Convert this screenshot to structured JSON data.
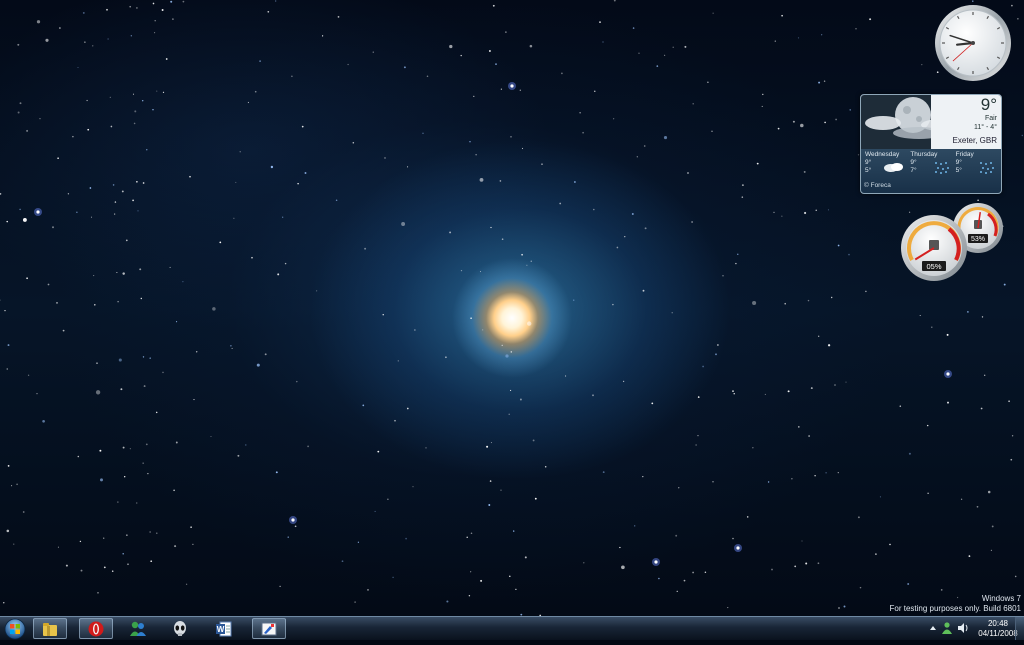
{
  "desktop": {
    "wallpaper": "galaxy-spiral"
  },
  "gadgets": {
    "clock": {
      "hour": 8,
      "minute": 48,
      "second": 38
    },
    "weather": {
      "temp": "9°",
      "condition": "Fair",
      "high": "11°",
      "separator": "-",
      "low": "4°",
      "location": "Exeter, GBR",
      "forecast": [
        {
          "day": "Wednesday",
          "high": "9°",
          "low": "5°",
          "icon": "cloudy-icon"
        },
        {
          "day": "Thursday",
          "high": "9°",
          "low": "7°",
          "icon": "rain-icon"
        },
        {
          "day": "Friday",
          "high": "9°",
          "low": "5°",
          "icon": "rain-icon"
        }
      ],
      "credit": "© Foreca"
    },
    "meter": {
      "cpu_label": "05%",
      "memory_label": "53%",
      "cpu": 0.05,
      "memory": 0.53
    }
  },
  "watermark": {
    "line1": "Windows 7",
    "line2": "For testing purposes only. Build 6801"
  },
  "taskbar": {
    "start_icon": "windows-orb-icon",
    "pinned": [
      {
        "name": "windows-explorer",
        "icon": "folder-icon",
        "active": true
      },
      {
        "name": "opera",
        "icon": "opera-icon",
        "active": true
      },
      {
        "name": "messenger",
        "icon": "messenger-icon",
        "active": false
      },
      {
        "name": "media-player",
        "icon": "alien-icon",
        "active": false
      },
      {
        "name": "word",
        "icon": "word-icon",
        "active": false
      },
      {
        "name": "paint",
        "icon": "paint-icon",
        "active": true
      }
    ],
    "tray": {
      "icons": [
        "show-hidden-icons-icon",
        "network-icon",
        "volume-icon"
      ],
      "time": "20:48",
      "date": "04/11/2008"
    }
  },
  "colors": {
    "accent": "#3f6fa0",
    "meter_red": "#d42020",
    "meter_orange": "#f0a020"
  }
}
